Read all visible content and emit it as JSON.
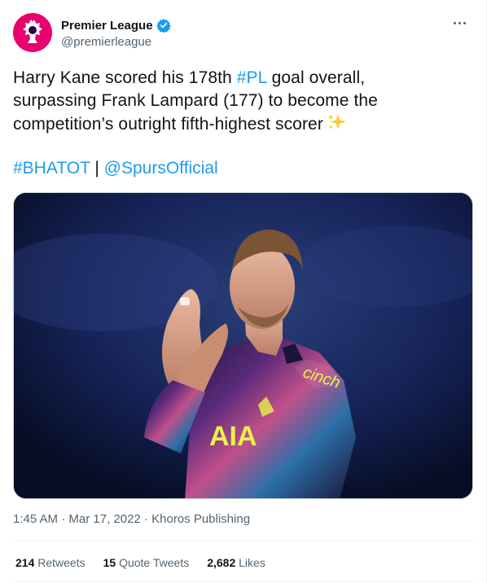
{
  "author": {
    "display_name": "Premier League",
    "handle": "@premierleague",
    "avatar_icon": "premier-league-lion-icon",
    "verified_icon": "verified-badge-icon",
    "brand_color": "#e8006f",
    "verified_color": "#1d9bf0"
  },
  "tweet": {
    "line1_a": "Harry Kane scored his 178th ",
    "line1_hashtag": "#PL",
    "line1_b": " goal overall,",
    "line2": "surpassing Frank Lampard (177) to become the",
    "line3": "competition’s outright fifth-highest scorer",
    "emoji_icon": "sparkles-icon",
    "hashtag2": "#BHATOT",
    "separator": " | ",
    "mention": "@SpursOfficial",
    "link_color": "#1d9bf0"
  },
  "media": {
    "description_icon": "player-applauding-photo",
    "jersey_sponsor": "cinch",
    "jersey_kit": "AIA"
  },
  "meta": {
    "time": "1:45 AM",
    "dot1": " · ",
    "date": "Mar 17, 2022",
    "dot2": " · ",
    "source": "Khoros Publishing"
  },
  "stats": {
    "retweets_count": "214",
    "retweets_label": " Retweets",
    "quotes_count": "15",
    "quotes_label": " Quote Tweets",
    "likes_count": "2,682",
    "likes_label": " Likes"
  }
}
